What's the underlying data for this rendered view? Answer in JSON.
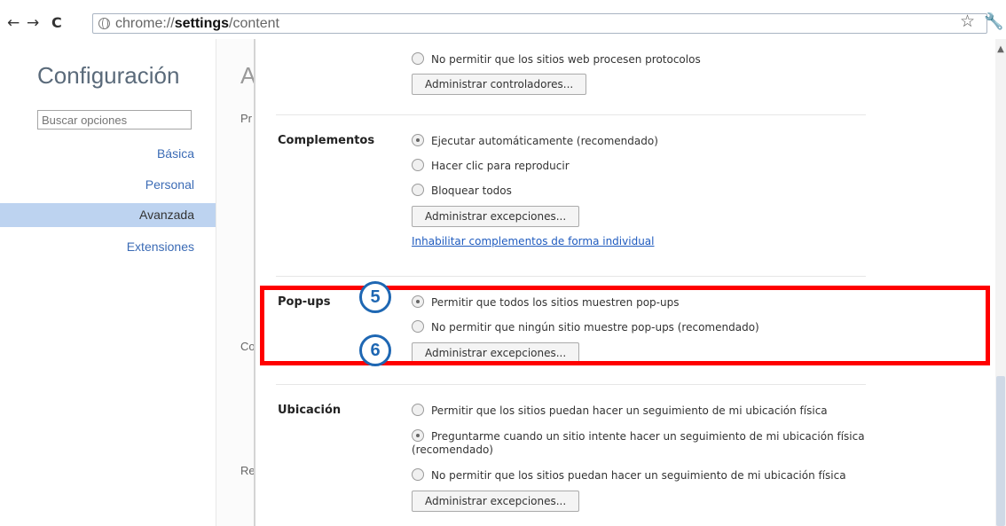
{
  "toolbar": {
    "back": "←",
    "forward": "→",
    "reload": "C",
    "url_prefix": "chrome://",
    "url_host": "settings",
    "url_path": "/content",
    "star": "☆",
    "wrench": "🔧"
  },
  "sidebar": {
    "title": "Configuración",
    "search_placeholder": "Buscar opciones",
    "items": [
      {
        "label": "Básica"
      },
      {
        "label": "Personal"
      },
      {
        "label": "Avanzada"
      },
      {
        "label": "Extensiones"
      }
    ],
    "behind_text": [
      "A",
      "Pr",
      "Co",
      "Re"
    ]
  },
  "content": {
    "protocols": {
      "option": "No permitir que los sitios web procesen protocolos",
      "button": "Administrar controladores..."
    },
    "plugins": {
      "title": "Complementos",
      "options": [
        {
          "label": "Ejecutar automáticamente (recomendado)",
          "checked": true
        },
        {
          "label": "Hacer clic para reproducir",
          "checked": false
        },
        {
          "label": "Bloquear todos",
          "checked": false
        }
      ],
      "button": "Administrar excepciones...",
      "link": "Inhabilitar complementos de forma individual"
    },
    "popups": {
      "title": "Pop-ups",
      "options": [
        {
          "label": "Permitir que todos los sitios muestren pop-ups",
          "checked": true
        },
        {
          "label": "No permitir que ningún sitio muestre pop-ups (recomendado)",
          "checked": false
        }
      ],
      "button": "Administrar excepciones..."
    },
    "location": {
      "title": "Ubicación",
      "options": [
        {
          "label": "Permitir que los sitios puedan hacer un seguimiento de mi ubicación física",
          "checked": false
        },
        {
          "label": "Preguntarme cuando un sitio intente hacer un seguimiento de mi ubicación física (recomendado)",
          "checked": true
        },
        {
          "label": "No permitir que los sitios puedan hacer un seguimiento de mi ubicación física",
          "checked": false
        }
      ],
      "button": "Administrar excepciones..."
    }
  },
  "annotations": {
    "marker_5": "5",
    "marker_6": "6",
    "highlight_color": "#ff0000",
    "marker_color": "#1e67b3"
  },
  "colors": {
    "sidebar_active_bg": "#bdd3f0",
    "link": "#1f5bbf",
    "sidebar_link": "#3b6bb5"
  }
}
